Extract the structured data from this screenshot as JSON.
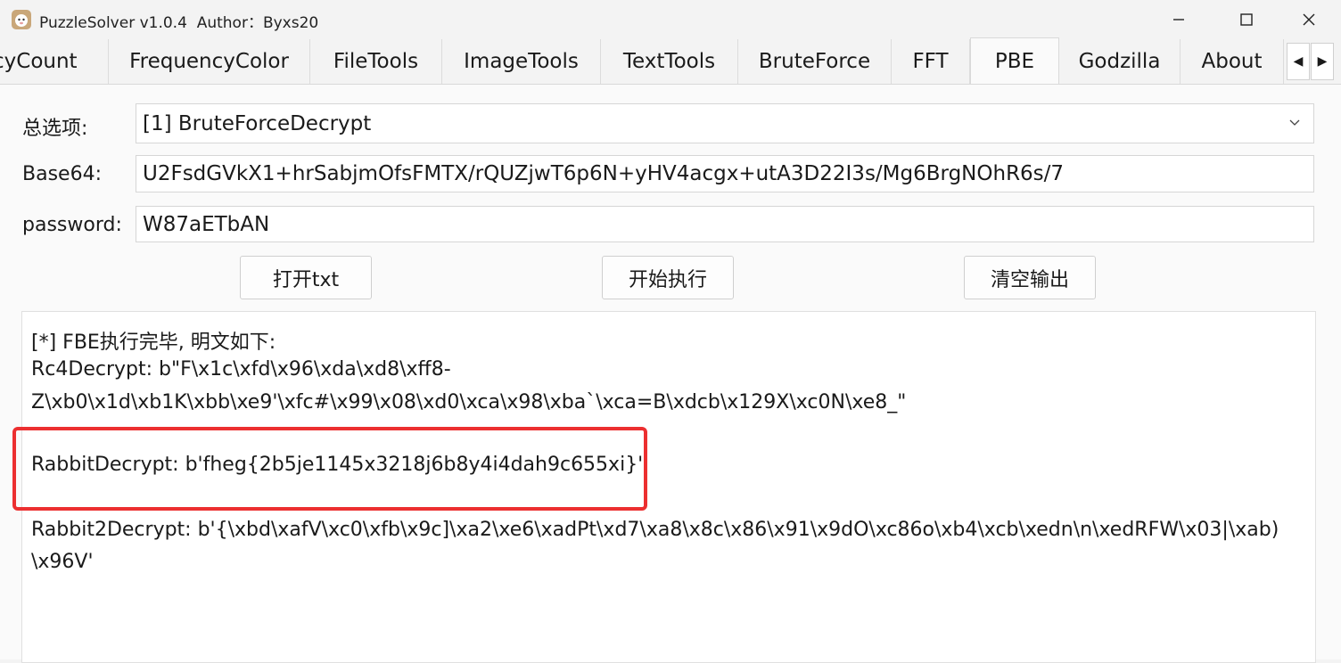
{
  "window": {
    "title": "PuzzleSolver v1.0.4  Author：Byxs20",
    "icon": "sheep-app-icon",
    "buttons": [
      "minimize-icon",
      "maximize-icon",
      "close-icon"
    ]
  },
  "tabs": [
    {
      "label": "cyCount",
      "active": false
    },
    {
      "label": "FrequencyColor",
      "active": false
    },
    {
      "label": "FileTools",
      "active": false
    },
    {
      "label": "ImageTools",
      "active": false
    },
    {
      "label": "TextTools",
      "active": false
    },
    {
      "label": "BruteForce",
      "active": false
    },
    {
      "label": "FFT",
      "active": false
    },
    {
      "label": "PBE",
      "active": true
    },
    {
      "label": "Godzilla",
      "active": false
    },
    {
      "label": "About",
      "active": false
    }
  ],
  "tab_scroll": {
    "left": "◀",
    "right": "▶"
  },
  "form": {
    "option_label": "总选项:",
    "option_value": "[1] BruteForceDecrypt",
    "base64_label": "Base64:",
    "base64_value": "U2FsdGVkX1+hrSabjmOfsFMTX/rQUZjwT6p6N+yHV4acgx+utA3D22I3s/Mg6BrgNOhR6s/7",
    "password_label": "password:",
    "password_value": "W87aETbAN"
  },
  "buttons": {
    "open_txt": "打开txt",
    "start": "开始执行",
    "clear": "清空输出"
  },
  "output": {
    "lines": [
      "[*] FBE执行完毕, 明文如下:",
      "Rc4Decrypt: b\"F\\x1c\\xfd\\x96\\xda\\xd8\\xff8-",
      "Z\\xb0\\x1d\\xb1K\\xbb\\xe9'\\xfc#\\x99\\x08\\xd0\\xca\\x98\\xba`\\xca=B\\xdcb\\x129X\\xc0N\\xe8_\"",
      "RabbitDecrypt: b'fheg{2b5je1145x3218j6b8y4i4dah9c655xi}'",
      "Rabbit2Decrypt: b'{\\xbd\\xafV\\xc0\\xfb\\x9c]\\xa2\\xe6\\xadPt\\xd7\\xa8\\x8c\\x86\\x91\\x9dO\\xc86o\\xb4\\xcb\\xedn\\n\\xedRFW\\x03|\\xab)",
      "\\x96V'"
    ],
    "highlight_color": "#ec2f30"
  }
}
